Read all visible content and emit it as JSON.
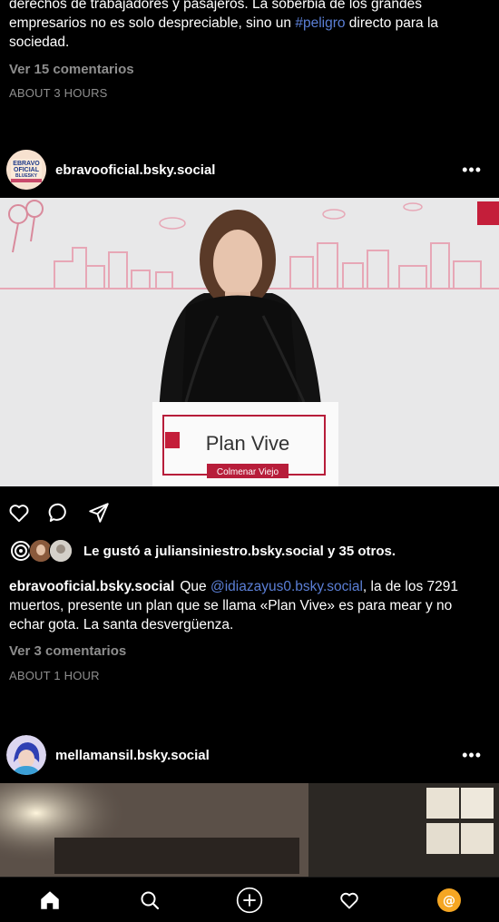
{
  "prev_post": {
    "text_line1": "derechos de trabajadores y pasajeros. La soberbia de los grandes",
    "text_line2_pre": "empresarios no es solo despreciable, sino un ",
    "hashtag": "#peligro",
    "text_line2_post": " directo para la",
    "text_line3": "sociedad.",
    "comments": "Ver 15 comentarios",
    "time": "ABOUT 3 HOURS"
  },
  "post": {
    "username": "ebravooficial.bsky.social",
    "avatar_text": [
      "EBRAVO",
      "OFICIAL",
      "BLUESKY"
    ],
    "image": {
      "podium_title": "Plan Vive",
      "podium_subtitle": "Colmenar Viejo"
    },
    "likes_text": "Le gustó a juliansiniestro.bsky.social y 35 otros.",
    "caption_user": "ebravooficial.bsky.social",
    "caption_mention": "@idiazayus0.bsky.social",
    "caption_line1_pre": "Que ",
    "caption_line1_post": ", la de los 7291",
    "caption_line2": "muertos, presente un plan que se llama «Plan Vive» es para mear y no",
    "caption_line3": "echar gota. La santa desvergüenza.",
    "comments": "Ver 3 comentarios",
    "time": "ABOUT 1 HOUR"
  },
  "next_post": {
    "username": "mellamansil.bsky.social"
  },
  "icons": {
    "like": "heart-icon",
    "comment": "comment-icon",
    "share": "send-icon",
    "home": "home-icon",
    "search": "search-icon",
    "create": "plus-circle-icon",
    "activity": "heart-icon",
    "profile": "at-icon"
  },
  "colors": {
    "link": "#5b7fd6",
    "muted": "#8e8e8e",
    "profile_accent": "#f5a623",
    "brand_red": "#c41e3a"
  }
}
